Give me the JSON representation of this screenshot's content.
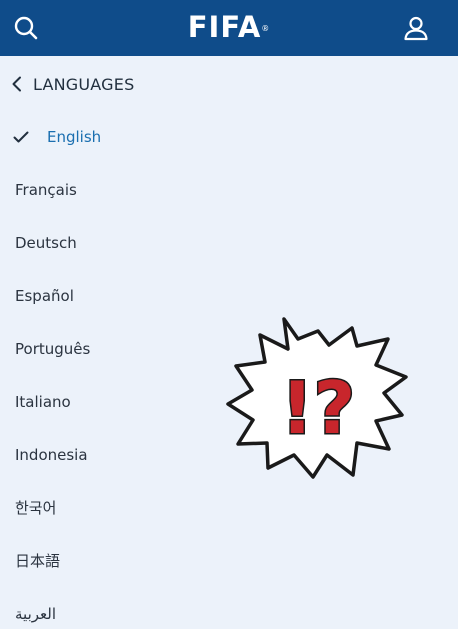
{
  "header": {
    "logo_text": "FIFA",
    "logo_mark": "®",
    "search_icon": "search-icon",
    "account_icon": "user-icon",
    "background_color": "#0f4c8a"
  },
  "nav": {
    "back_icon": "chevron-left-icon",
    "title": "LANGUAGES"
  },
  "languages": {
    "selected_index": 0,
    "selected_color": "#1a6fb0",
    "check_icon": "checkmark-icon",
    "items": [
      {
        "label": "English"
      },
      {
        "label": "Français"
      },
      {
        "label": "Deutsch"
      },
      {
        "label": "Español"
      },
      {
        "label": "Português"
      },
      {
        "label": "Italiano"
      },
      {
        "label": "Indonesia"
      },
      {
        "label": "한국어"
      },
      {
        "label": "日本語"
      },
      {
        "label": "العربية"
      }
    ]
  },
  "overlay": {
    "sticker_icon": "exclamation-question-burst-icon",
    "text": "!?",
    "text_color": "#c8262c"
  }
}
